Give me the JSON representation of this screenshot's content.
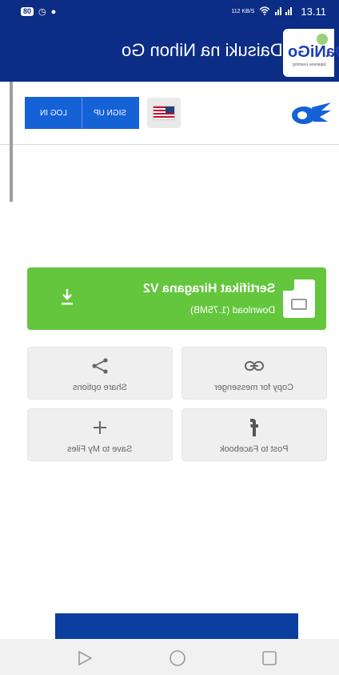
{
  "status_bar": {
    "battery": "80",
    "time": "13.11",
    "net_speed": "112 KB/S"
  },
  "app_bar": {
    "title": "Daisuki na Nihon Go",
    "logo_text": "DaNiGo",
    "logo_sub": "Japanese Learning"
  },
  "web_header": {
    "login_label": "LOG IN",
    "signup_label": "SIGN UP",
    "language_flag": "us-flag-icon",
    "site_logo": "brand-logo-icon"
  },
  "download": {
    "file_name": "Sertifikat Hiragana V2",
    "file_size": "Download (1.75MB)",
    "icon": "file-image-icon",
    "action_icon": "download-icon",
    "color": "#63c63c"
  },
  "share": {
    "copy_label": "Copy for messenger",
    "share_label": "Share options",
    "facebook_label": "Post to Facebook",
    "save_label": "Save to My Files"
  },
  "colors": {
    "header_blue": "#0b2d86",
    "button_blue": "#1561d6",
    "green": "#63c63c"
  }
}
